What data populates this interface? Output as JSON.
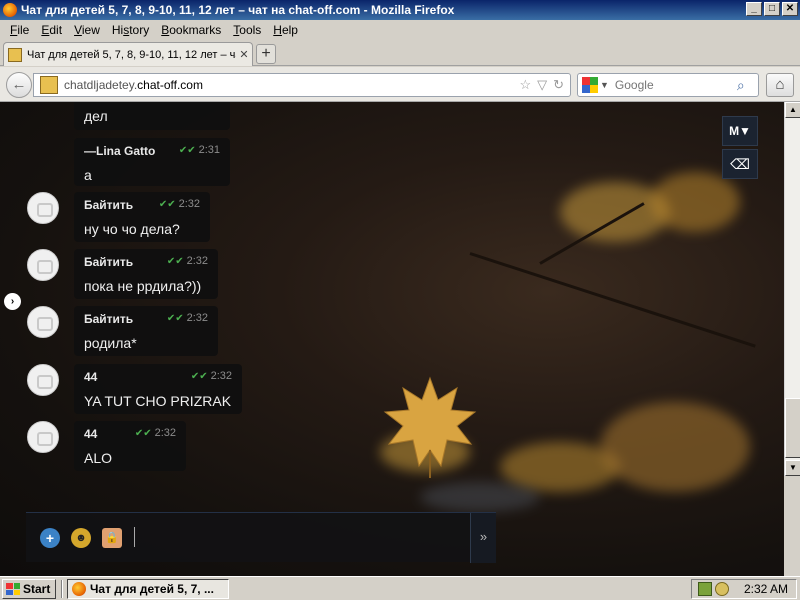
{
  "window": {
    "title": "Чат для детей 5, 7, 8, 9-10, 11, 12 лет – чат на chat-off.com - Mozilla Firefox",
    "controls": {
      "minimize": "_",
      "maximize": "□",
      "close": "✕"
    }
  },
  "menubar": [
    {
      "key": "F",
      "rest": "ile"
    },
    {
      "key": "E",
      "rest": "dit"
    },
    {
      "key": "V",
      "rest": "iew"
    },
    {
      "pre": "Hi",
      "key": "s",
      "rest": "tory"
    },
    {
      "key": "B",
      "rest": "ookmarks"
    },
    {
      "key": "T",
      "rest": "ools"
    },
    {
      "key": "H",
      "rest": "elp"
    }
  ],
  "tab": {
    "title": "Чат для детей 5, 7, 8, 9-10, 11, 12 лет – чат ...",
    "close": "✕",
    "new_tab": "+"
  },
  "navbar": {
    "url_prefix": "chatdljadetey.",
    "url_host": "chat-off.com",
    "search_placeholder": "Google",
    "back_icon": "←",
    "home_icon": "⌂",
    "bookmark_icon": "☆",
    "dropdown_icon": "▽",
    "reload_icon": "↻",
    "search_go_icon": "⌕",
    "engine_dropdown": "▼"
  },
  "chat": {
    "messages": [
      {
        "author": "",
        "time": "",
        "text": "дел",
        "has_avatar": false,
        "partial": true
      },
      {
        "author": "—Lina Gatto",
        "time": "2:31",
        "text": "а",
        "has_avatar": false
      },
      {
        "author": "Байтить",
        "time": "2:32",
        "text": "ну чо чо дела?",
        "has_avatar": true
      },
      {
        "author": "Байтить",
        "time": "2:32",
        "text": "пока не ррдила?))",
        "has_avatar": true
      },
      {
        "author": "Байтить",
        "time": "2:32",
        "text": "родила*",
        "has_avatar": true
      },
      {
        "author": "44",
        "time": "2:32",
        "text": "YA TUT CHO PRIZRAK",
        "has_avatar": true
      },
      {
        "author": "44",
        "time": "2:32",
        "text": "ALO",
        "has_avatar": true
      }
    ],
    "check_mark": "✔✔",
    "side_toggle": "›",
    "tool_font": "M▼",
    "tool_eraser": "⌫",
    "composer_add": "+",
    "composer_smile": "☻",
    "composer_lock": "🔒",
    "composer_send": "»"
  },
  "scrollbar": {
    "up": "▲",
    "down": "▼"
  },
  "taskbar": {
    "start_label": "Start",
    "task_label": "Чат для детей 5, 7, ...",
    "clock": "2:32 AM"
  },
  "colors": {
    "titlebar": "#0a246a",
    "check": "#4caf50",
    "leaf": "#d9a441",
    "add_button": "#3b82c6"
  }
}
